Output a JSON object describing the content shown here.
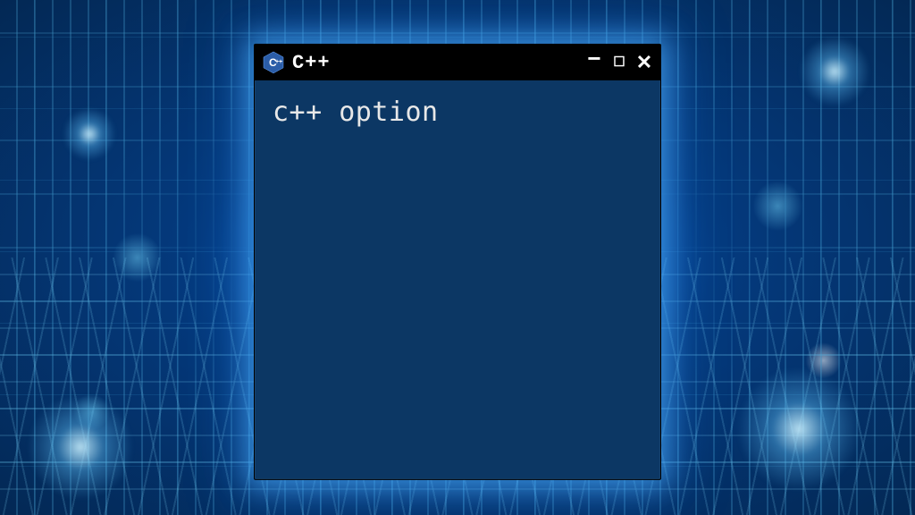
{
  "window": {
    "title": "C++",
    "icon_label": "C++",
    "controls": {
      "minimize": "−",
      "maximize": "□",
      "close": "✕"
    }
  },
  "body": {
    "content": "c++ option"
  }
}
